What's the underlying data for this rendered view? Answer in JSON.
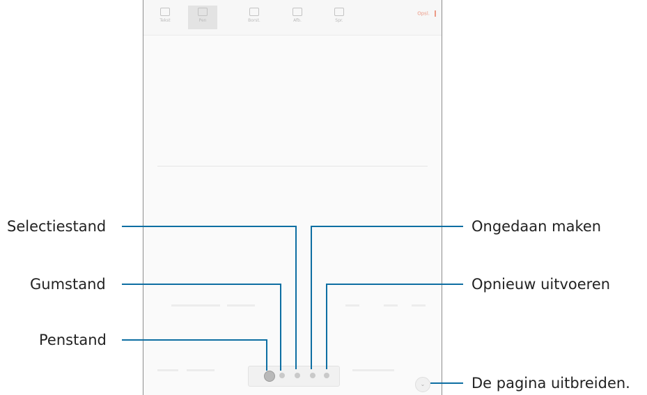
{
  "toolbar": {
    "buttons": [
      {
        "label": "Tekst",
        "icon": "text-icon"
      },
      {
        "label": "Pen",
        "icon": "pen-icon",
        "active": true
      },
      {
        "label": "Borst.",
        "icon": "brush-icon"
      },
      {
        "label": "Afb.",
        "icon": "image-icon"
      },
      {
        "label": "Spr.",
        "icon": "voice-icon"
      }
    ],
    "save_label": "Opsl."
  },
  "callouts": {
    "selectiestand": "Selectiestand",
    "gumstand": "Gumstand",
    "penstand": "Penstand",
    "ongedaan_maken": "Ongedaan maken",
    "opnieuw_uitvoeren": "Opnieuw uitvoeren",
    "pagina_uitbreiden": "De pagina uitbreiden."
  },
  "colors": {
    "callout_line": "#0d6ea2",
    "accent": "#ec9a86"
  }
}
